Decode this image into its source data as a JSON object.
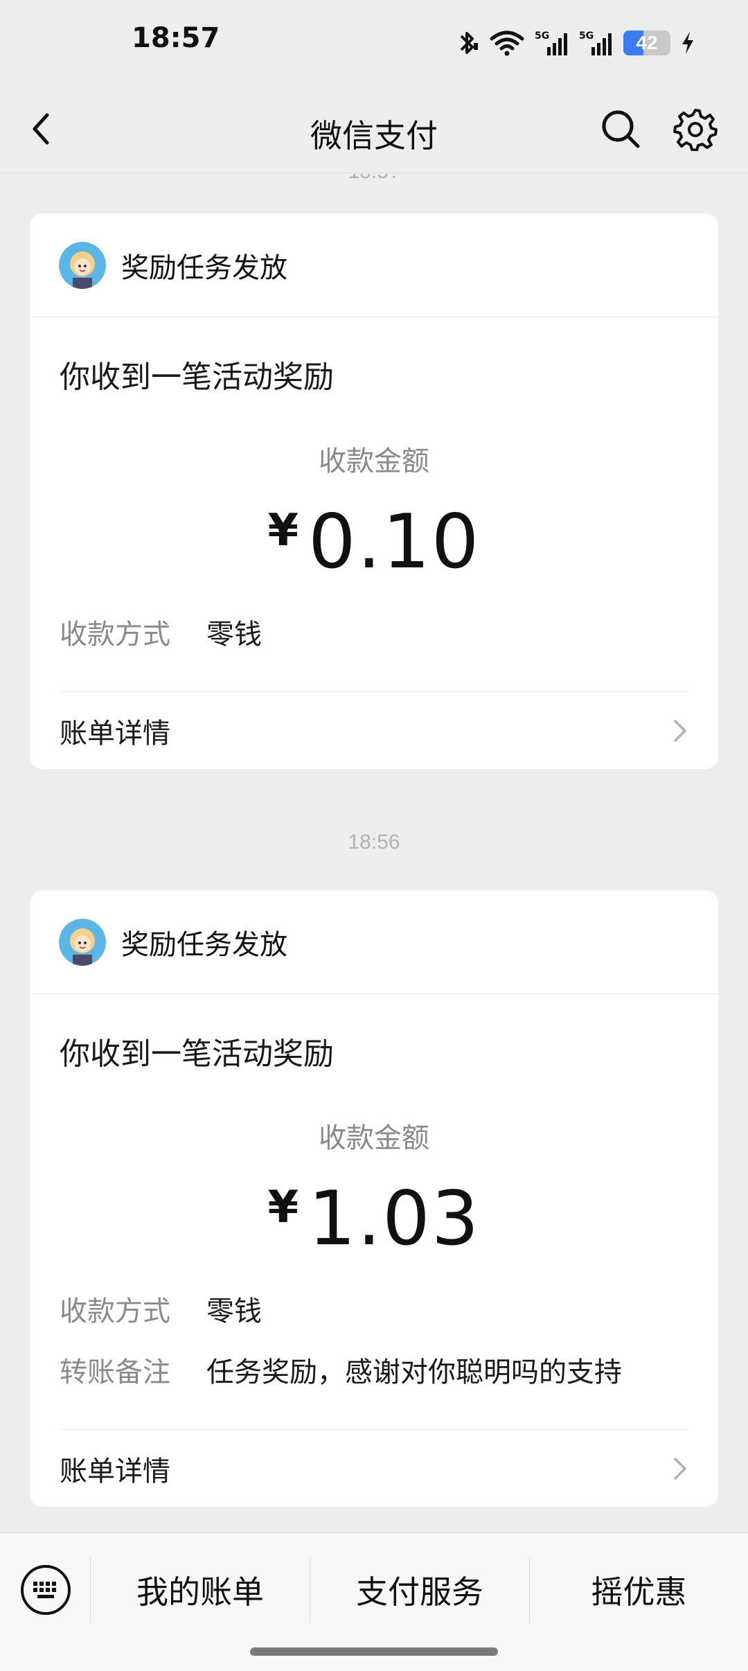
{
  "status_bar": {
    "time": "18:57",
    "battery_level": "42",
    "icons": [
      "bluetooth-icon",
      "wifi-icon",
      "signal-5g-icon",
      "signal-5g-icon",
      "battery-icon",
      "charging-icon"
    ]
  },
  "nav": {
    "title": "微信支付",
    "back_icon": "chevron-left-icon",
    "search_icon": "search-icon",
    "settings_icon": "gear-icon"
  },
  "messages": [
    {
      "partial_time_above": "18:5?",
      "source": "奖励任务发放",
      "title": "你收到一笔活动奖励",
      "amount_label": "收款金额",
      "currency": "¥",
      "amount": "0.10",
      "details": [
        {
          "key": "收款方式",
          "value": "零钱"
        }
      ],
      "bill_label": "账单详情"
    },
    {
      "time": "18:56",
      "source": "奖励任务发放",
      "title": "你收到一笔活动奖励",
      "amount_label": "收款金额",
      "currency": "¥",
      "amount": "1.03",
      "details": [
        {
          "key": "收款方式",
          "value": "零钱"
        },
        {
          "key": "转账备注",
          "value": "任务奖励，感谢对你聪明吗的支持"
        }
      ],
      "bill_label": "账单详情"
    }
  ],
  "bottom_menu": {
    "keyboard_icon": "keyboard-icon",
    "items": [
      "我的账单",
      "支付服务",
      "摇优惠"
    ]
  },
  "colors": {
    "background": "#ededed",
    "card": "#ffffff",
    "muted_text": "#8a8a8a",
    "battery_fill": "#3b7df0"
  }
}
